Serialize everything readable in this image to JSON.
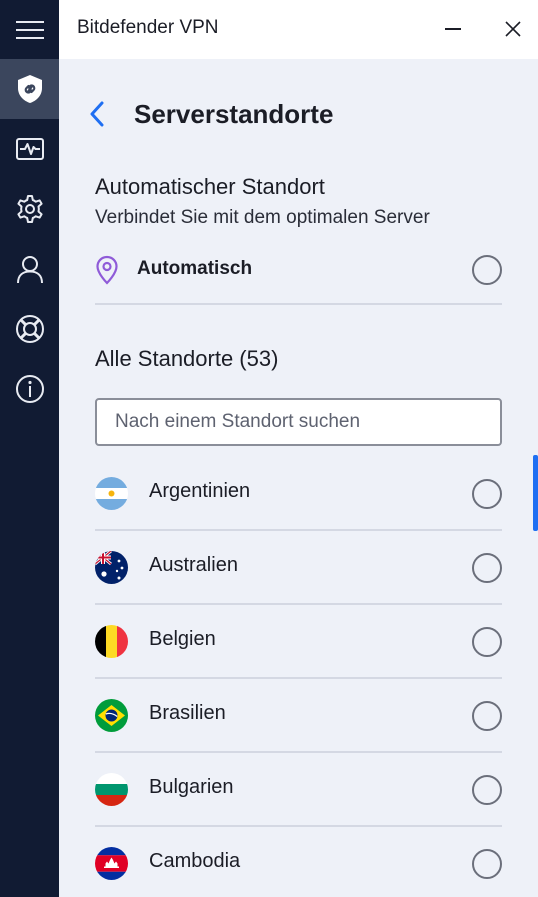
{
  "window": {
    "title": "Bitdefender VPN"
  },
  "sidebar": {
    "items": [
      {
        "icon": "shield-link-icon",
        "active": true
      },
      {
        "icon": "activity-monitor-icon",
        "active": false
      },
      {
        "icon": "gear-icon",
        "active": false
      },
      {
        "icon": "user-icon",
        "active": false
      },
      {
        "icon": "lifebuoy-icon",
        "active": false
      },
      {
        "icon": "info-icon",
        "active": false
      }
    ]
  },
  "page": {
    "title": "Serverstandorte"
  },
  "auto_section": {
    "title": "Automatischer Standort",
    "subtitle": "Verbindet Sie mit dem optimalen Server",
    "option_label": "Automatisch",
    "selected": false
  },
  "locations": {
    "title": "Alle Standorte (53)",
    "search_placeholder": "Nach einem Standort suchen",
    "items": [
      {
        "name": "Argentinien",
        "flag": "argentina-flag",
        "selected": false
      },
      {
        "name": "Australien",
        "flag": "australia-flag",
        "selected": false
      },
      {
        "name": "Belgien",
        "flag": "belgium-flag",
        "selected": false
      },
      {
        "name": "Brasilien",
        "flag": "brazil-flag",
        "selected": false
      },
      {
        "name": "Bulgarien",
        "flag": "bulgaria-flag",
        "selected": false
      },
      {
        "name": "Cambodia",
        "flag": "cambodia-flag",
        "selected": false
      }
    ]
  },
  "colors": {
    "sidebar_bg": "#111b33",
    "sidebar_active": "#3b465d",
    "accent": "#1f6ff2",
    "content_bg": "#eef1f8",
    "pin": "#8f5bd8"
  }
}
